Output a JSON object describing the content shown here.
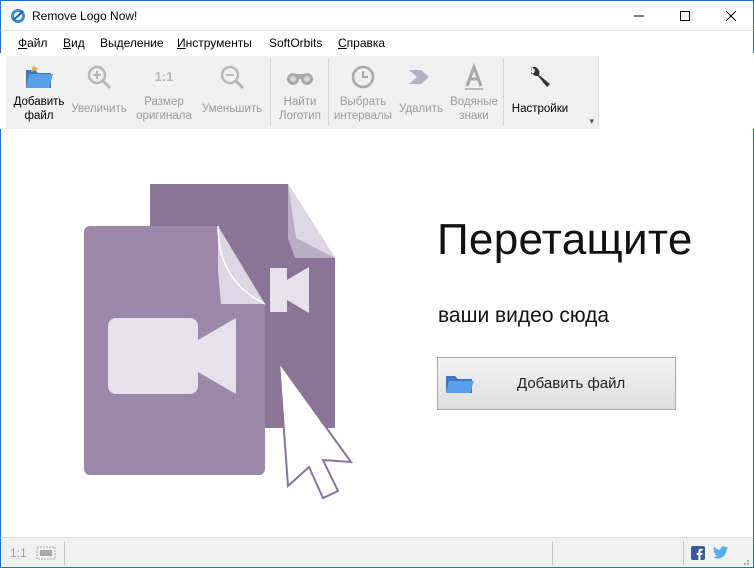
{
  "window": {
    "title": "Remove Logo Now!"
  },
  "menu": {
    "items": [
      {
        "accel": "Ф",
        "rest": "айл"
      },
      {
        "accel": "В",
        "rest": "ид"
      },
      {
        "accel": "",
        "rest": "Выделение"
      },
      {
        "accel": "И",
        "rest": "нструменты"
      },
      {
        "accel": "",
        "rest": "SoftOrbits"
      },
      {
        "accel": "С",
        "rest": "правка"
      }
    ]
  },
  "toolbar": {
    "add_file": [
      "Добавить",
      "файл"
    ],
    "zoom_in": "Увеличить",
    "orig_size_icon": "1:1",
    "orig_size": [
      "Размер",
      "оригинала"
    ],
    "zoom_out": "Уменьшить",
    "find_logos": [
      "Найти",
      "Логотип"
    ],
    "select_intervals": [
      "Выбрать",
      "интервалы"
    ],
    "remove": "Удалить",
    "watermarks": [
      "Водяные",
      "знаки"
    ],
    "settings": "Настройки"
  },
  "drop": {
    "title": "Перетащите",
    "subtitle": "ваши видео сюда",
    "button": "Добавить файл"
  },
  "status": {
    "zoom": "1:1"
  },
  "colors": {
    "accent": "#1e73c8",
    "video_icon": "#9b88a8",
    "video_icon_dark": "#8a7598"
  }
}
